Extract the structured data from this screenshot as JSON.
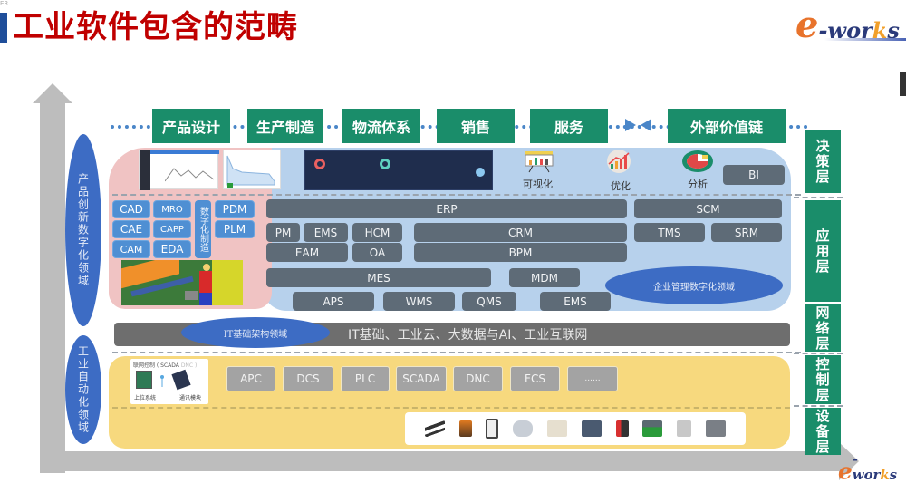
{
  "header": {
    "tiny_tag": "ER",
    "title": "工业软件包含的范畴",
    "logo": {
      "e": "e",
      "dash_wor": "-wor",
      "k": "k",
      "s": "s"
    }
  },
  "colors": {
    "title_red": "#c00000",
    "green": "#1a8d6a",
    "domain_blue": "#3d6cc4",
    "box_gray": "#5e6b77",
    "product_pink": "#f0c3c3",
    "enterprise_blue": "#b7d1ec",
    "automation_yellow": "#f7d97e"
  },
  "value_chain": [
    "产品设计",
    "生产制造",
    "物流体系",
    "销售",
    "服务",
    "外部价值链"
  ],
  "domains": {
    "product": "产品创新数字化领域",
    "automation": "工业自动化领域",
    "enterprise": "企业管理数字化领域",
    "it": "IT基础架构领域"
  },
  "product_area": {
    "boxes": [
      "CAD",
      "MRO",
      "PDM",
      "CAE",
      "CAPP",
      "PLM",
      "CAM",
      "EDA"
    ],
    "vertical": "数字化制造"
  },
  "decision_icons": [
    {
      "icon": "bar-chart-board-icon",
      "label": "可视化"
    },
    {
      "icon": "growth-chart-icon",
      "label": "优化"
    },
    {
      "icon": "pie-chart-icon",
      "label": "分析"
    }
  ],
  "bi_label": "BI",
  "enterprise_boxes": {
    "erp": "ERP",
    "scm": "SCM",
    "pm": "PM",
    "ems1": "EMS",
    "hcm": "HCM",
    "crm": "CRM",
    "tms": "TMS",
    "srm": "SRM",
    "eam": "EAM",
    "oa": "OA",
    "bpm": "BPM",
    "mes": "MES",
    "mdm": "MDM",
    "aps": "APS",
    "wms": "WMS",
    "qms": "QMS",
    "ems2": "EMS"
  },
  "it_bar": "IT基础、工业云、大数据与AI、工业互联网",
  "automation": {
    "scada_card": {
      "title": "联网控制 ( SCADA",
      "faded": "DNC )",
      "left_label": "上位系统",
      "right_label": "通讯模块"
    },
    "boxes": [
      "APC",
      "DCS",
      "PLC",
      "SCADA",
      "DNC",
      "FCS",
      "......"
    ]
  },
  "devices": [
    "power-tools-icon",
    "robot-arm-icon",
    "machine-frame-icon",
    "agv-icon",
    "printer-icon",
    "cnc-machine-icon",
    "barcode-scanner-icon",
    "injection-machine-icon",
    "meter-icon",
    "assembly-line-icon"
  ],
  "layers": [
    "决策层",
    "应用层",
    "网络层",
    "控制层",
    "设备层"
  ]
}
